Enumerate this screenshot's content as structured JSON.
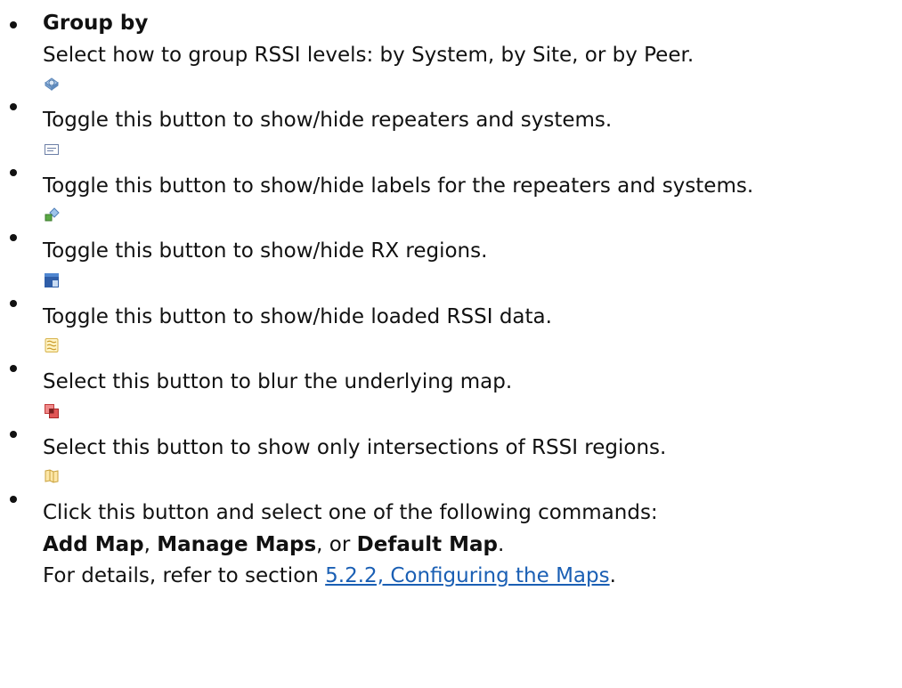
{
  "items": [
    {
      "title": "Group by",
      "desc": "Select how to group RSSI levels: by System, by Site, or by Peer."
    },
    {
      "icon": "repeater-system-icon",
      "desc": "Toggle this button to show/hide repeaters and systems."
    },
    {
      "icon": "label-icon",
      "desc": "Toggle this button to show/hide labels for the repeaters and systems."
    },
    {
      "icon": "rx-region-icon",
      "desc": "Toggle this button to show/hide RX regions."
    },
    {
      "icon": "rssi-data-icon",
      "desc": "Toggle this button to show/hide loaded RSSI data."
    },
    {
      "icon": "blur-map-icon",
      "desc": "Select this button to blur the underlying map."
    },
    {
      "icon": "intersection-icon",
      "desc": "Select this button to show only intersections of RSSI regions."
    },
    {
      "icon": "map-icon",
      "line1": "Click this button and select one of the following commands:",
      "cmd1": "Add Map",
      "sep1": ", ",
      "cmd2": "Manage Maps",
      "sep2": ", or ",
      "cmd3": "Default Map",
      "end2": ".",
      "ref_prefix": "For details, refer to section ",
      "ref_link": "5.2.2, Configuring the Maps",
      "ref_suffix": "."
    }
  ]
}
